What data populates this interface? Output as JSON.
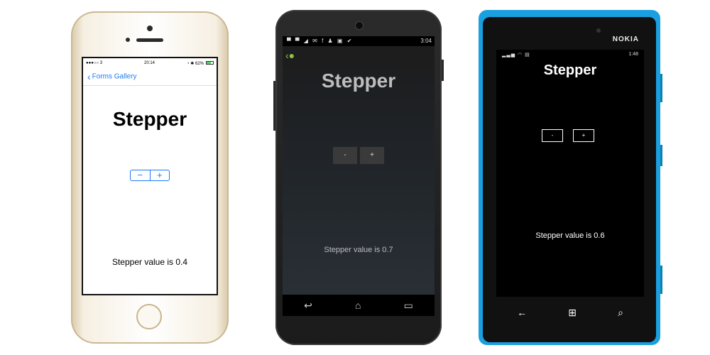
{
  "ios": {
    "status": {
      "carrier": "●●●○○ 3 ",
      "time": "20:14",
      "right": "◔ ✱ 62%"
    },
    "nav": {
      "back_label": "Forms Gallery"
    },
    "title": "Stepper",
    "stepper": {
      "minus": "−",
      "plus": "+"
    },
    "value_text": "Stepper value is 0.4",
    "colors": {
      "accent": "#1a7af8",
      "frame": "#f6efe2"
    }
  },
  "android": {
    "status": {
      "time": "3:04"
    },
    "title": "Stepper",
    "stepper": {
      "minus": "-",
      "plus": "+"
    },
    "value_text": "Stepper value is 0.7",
    "nav": {
      "back": "↩",
      "home": "⌂",
      "recents": "▭"
    },
    "colors": {
      "bg": "#23282d",
      "text": "#bdbdbd"
    }
  },
  "windows_phone": {
    "brand": "NOKIA",
    "status": {
      "time": "1:48"
    },
    "title": "Stepper",
    "stepper": {
      "minus": "-",
      "plus": "+"
    },
    "value_text": "Stepper value is 0.6",
    "nav": {
      "back": "←",
      "start": "⊞",
      "search": "⌕"
    },
    "colors": {
      "body": "#1aa0e0",
      "bg": "#000000"
    }
  }
}
